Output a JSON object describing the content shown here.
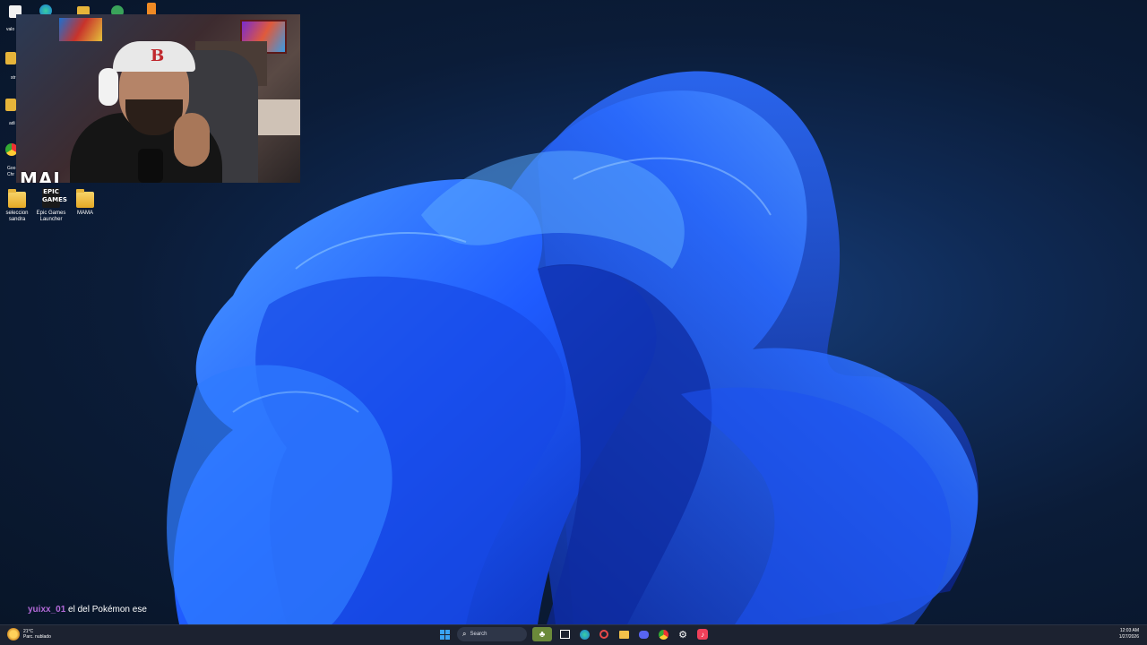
{
  "desktop": {
    "icons": [
      {
        "label": "seleccion sandra",
        "icon": "folder-icon"
      },
      {
        "label": "Epic Games Launcher",
        "icon": "epic-games-icon",
        "logo_text": "EPIC GAMES"
      },
      {
        "label": "MAMA",
        "icon": "folder-icon"
      }
    ],
    "partial_labels": {
      "top": "valo",
      "row2": "str",
      "row3": "adi",
      "row4": "Goo Chr"
    }
  },
  "webcam": {
    "overlay_text": "MAI",
    "cap_letter": "B"
  },
  "chat": {
    "username": "yuixx_01",
    "message": "el del Pokémon ese"
  },
  "taskbar": {
    "weather": {
      "temperature": "21°C",
      "condition": "Parc. nublado"
    },
    "search_label": "Search",
    "pinned": [
      "game-icon",
      "task-view-icon",
      "edge-icon",
      "clock-icon",
      "file-explorer-icon",
      "discord-icon",
      "chrome-icon",
      "settings-icon",
      "music-icon"
    ],
    "clock": {
      "time": "12:03 AM",
      "date": "1/27/2026"
    }
  },
  "colors": {
    "accent": "#3aa3f4",
    "chat_user": "#b36ad9",
    "wallpaper_bloom": "#1f5cff"
  }
}
